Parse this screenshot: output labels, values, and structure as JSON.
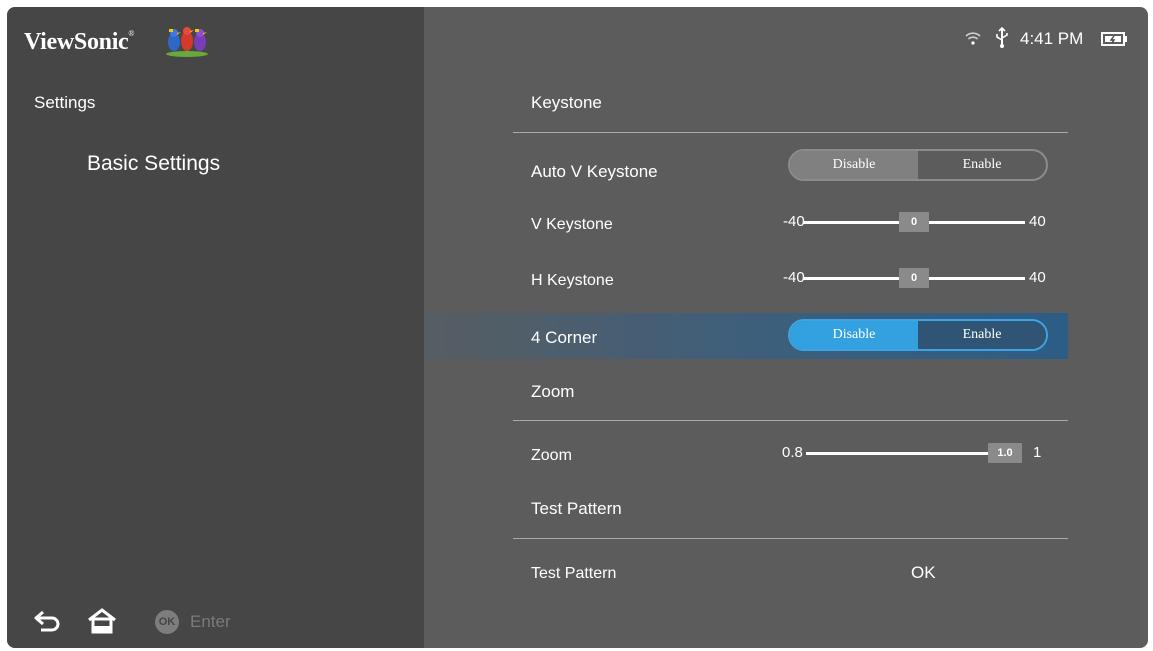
{
  "brand": {
    "name": "ViewSonic",
    "trademark": "®"
  },
  "sidebar": {
    "title": "Settings",
    "item": "Basic Settings"
  },
  "footer": {
    "back_icon": "back-arrow-icon",
    "home_icon": "home-icon",
    "ok_badge": "OK",
    "enter_label": "Enter"
  },
  "status": {
    "wifi_icon": "wifi-icon",
    "usb_icon": "usb-icon",
    "time": "4:41 PM",
    "battery_icon": "battery-charging-icon"
  },
  "sections": {
    "keystone": "Keystone",
    "zoom": "Zoom",
    "test_pattern": "Test Pattern"
  },
  "rows": {
    "auto_v_keystone": {
      "label": "Auto V Keystone",
      "options": [
        "Disable",
        "Enable"
      ],
      "selected": "Disable"
    },
    "v_keystone": {
      "label": "V Keystone",
      "min": "-40",
      "max": "40",
      "value": "0",
      "fraction": 0.5
    },
    "h_keystone": {
      "label": "H Keystone",
      "min": "-40",
      "max": "40",
      "value": "0",
      "fraction": 0.5
    },
    "four_corner": {
      "label": "4 Corner",
      "options": [
        "Disable",
        "Enable"
      ],
      "selected": "Disable"
    },
    "zoom": {
      "label": "Zoom",
      "min": "0.8",
      "max": "1",
      "value": "1.0",
      "fraction": 1.0
    },
    "test_pattern": {
      "label": "Test Pattern",
      "value": "OK"
    }
  },
  "colors": {
    "accent": "#33a1df",
    "sidebar_bg": "#464646",
    "main_bg": "#5c5c5c"
  }
}
